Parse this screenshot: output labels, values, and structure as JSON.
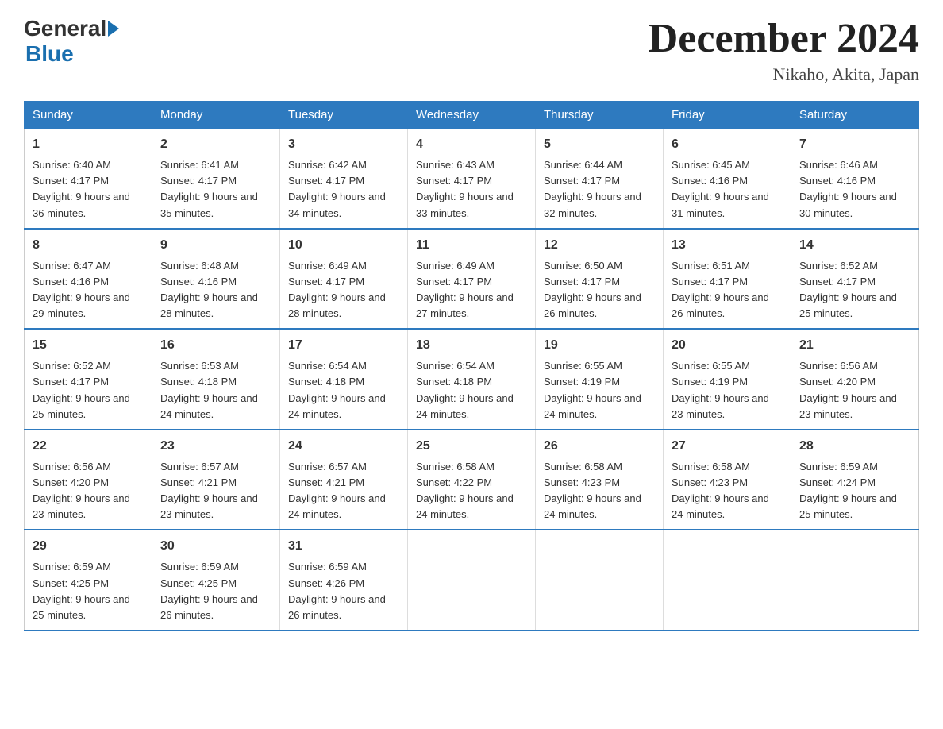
{
  "logo": {
    "general": "General",
    "blue": "Blue"
  },
  "title": "December 2024",
  "subtitle": "Nikaho, Akita, Japan",
  "weekdays": [
    "Sunday",
    "Monday",
    "Tuesday",
    "Wednesday",
    "Thursday",
    "Friday",
    "Saturday"
  ],
  "weeks": [
    [
      {
        "day": "1",
        "sunrise": "6:40 AM",
        "sunset": "4:17 PM",
        "daylight": "9 hours and 36 minutes."
      },
      {
        "day": "2",
        "sunrise": "6:41 AM",
        "sunset": "4:17 PM",
        "daylight": "9 hours and 35 minutes."
      },
      {
        "day": "3",
        "sunrise": "6:42 AM",
        "sunset": "4:17 PM",
        "daylight": "9 hours and 34 minutes."
      },
      {
        "day": "4",
        "sunrise": "6:43 AM",
        "sunset": "4:17 PM",
        "daylight": "9 hours and 33 minutes."
      },
      {
        "day": "5",
        "sunrise": "6:44 AM",
        "sunset": "4:17 PM",
        "daylight": "9 hours and 32 minutes."
      },
      {
        "day": "6",
        "sunrise": "6:45 AM",
        "sunset": "4:16 PM",
        "daylight": "9 hours and 31 minutes."
      },
      {
        "day": "7",
        "sunrise": "6:46 AM",
        "sunset": "4:16 PM",
        "daylight": "9 hours and 30 minutes."
      }
    ],
    [
      {
        "day": "8",
        "sunrise": "6:47 AM",
        "sunset": "4:16 PM",
        "daylight": "9 hours and 29 minutes."
      },
      {
        "day": "9",
        "sunrise": "6:48 AM",
        "sunset": "4:16 PM",
        "daylight": "9 hours and 28 minutes."
      },
      {
        "day": "10",
        "sunrise": "6:49 AM",
        "sunset": "4:17 PM",
        "daylight": "9 hours and 28 minutes."
      },
      {
        "day": "11",
        "sunrise": "6:49 AM",
        "sunset": "4:17 PM",
        "daylight": "9 hours and 27 minutes."
      },
      {
        "day": "12",
        "sunrise": "6:50 AM",
        "sunset": "4:17 PM",
        "daylight": "9 hours and 26 minutes."
      },
      {
        "day": "13",
        "sunrise": "6:51 AM",
        "sunset": "4:17 PM",
        "daylight": "9 hours and 26 minutes."
      },
      {
        "day": "14",
        "sunrise": "6:52 AM",
        "sunset": "4:17 PM",
        "daylight": "9 hours and 25 minutes."
      }
    ],
    [
      {
        "day": "15",
        "sunrise": "6:52 AM",
        "sunset": "4:17 PM",
        "daylight": "9 hours and 25 minutes."
      },
      {
        "day": "16",
        "sunrise": "6:53 AM",
        "sunset": "4:18 PM",
        "daylight": "9 hours and 24 minutes."
      },
      {
        "day": "17",
        "sunrise": "6:54 AM",
        "sunset": "4:18 PM",
        "daylight": "9 hours and 24 minutes."
      },
      {
        "day": "18",
        "sunrise": "6:54 AM",
        "sunset": "4:18 PM",
        "daylight": "9 hours and 24 minutes."
      },
      {
        "day": "19",
        "sunrise": "6:55 AM",
        "sunset": "4:19 PM",
        "daylight": "9 hours and 24 minutes."
      },
      {
        "day": "20",
        "sunrise": "6:55 AM",
        "sunset": "4:19 PM",
        "daylight": "9 hours and 23 minutes."
      },
      {
        "day": "21",
        "sunrise": "6:56 AM",
        "sunset": "4:20 PM",
        "daylight": "9 hours and 23 minutes."
      }
    ],
    [
      {
        "day": "22",
        "sunrise": "6:56 AM",
        "sunset": "4:20 PM",
        "daylight": "9 hours and 23 minutes."
      },
      {
        "day": "23",
        "sunrise": "6:57 AM",
        "sunset": "4:21 PM",
        "daylight": "9 hours and 23 minutes."
      },
      {
        "day": "24",
        "sunrise": "6:57 AM",
        "sunset": "4:21 PM",
        "daylight": "9 hours and 24 minutes."
      },
      {
        "day": "25",
        "sunrise": "6:58 AM",
        "sunset": "4:22 PM",
        "daylight": "9 hours and 24 minutes."
      },
      {
        "day": "26",
        "sunrise": "6:58 AM",
        "sunset": "4:23 PM",
        "daylight": "9 hours and 24 minutes."
      },
      {
        "day": "27",
        "sunrise": "6:58 AM",
        "sunset": "4:23 PM",
        "daylight": "9 hours and 24 minutes."
      },
      {
        "day": "28",
        "sunrise": "6:59 AM",
        "sunset": "4:24 PM",
        "daylight": "9 hours and 25 minutes."
      }
    ],
    [
      {
        "day": "29",
        "sunrise": "6:59 AM",
        "sunset": "4:25 PM",
        "daylight": "9 hours and 25 minutes."
      },
      {
        "day": "30",
        "sunrise": "6:59 AM",
        "sunset": "4:25 PM",
        "daylight": "9 hours and 26 minutes."
      },
      {
        "day": "31",
        "sunrise": "6:59 AM",
        "sunset": "4:26 PM",
        "daylight": "9 hours and 26 minutes."
      },
      null,
      null,
      null,
      null
    ]
  ]
}
